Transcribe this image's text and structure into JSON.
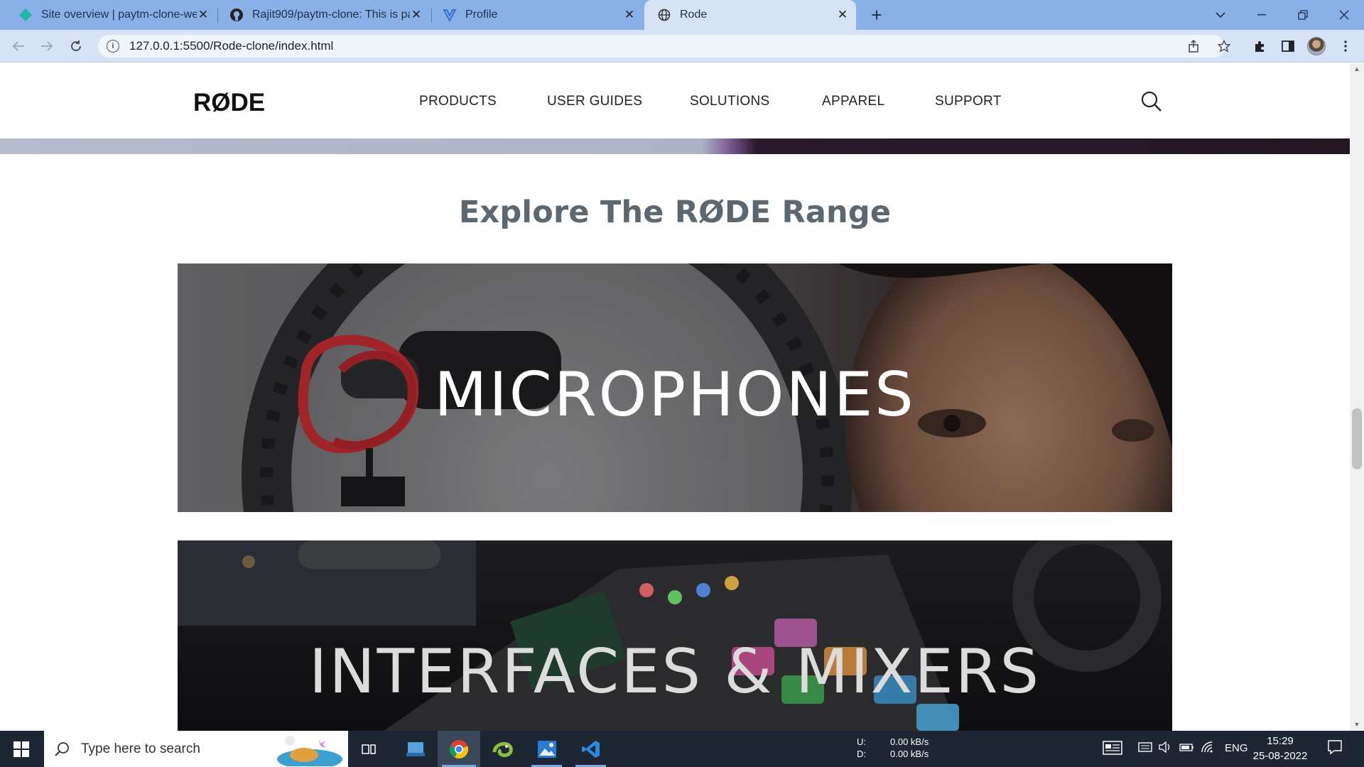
{
  "browser": {
    "tabs": [
      {
        "title": "Site overview | paytm-clone-web",
        "icon": "netlify-icon"
      },
      {
        "title": "Rajit909/paytm-clone: This is pay",
        "icon": "github-icon"
      },
      {
        "title": "Profile",
        "icon": "vite-icon"
      },
      {
        "title": "Rode",
        "icon": "globe-icon"
      }
    ],
    "url": "127.0.0.1:5500/Rode-clone/index.html"
  },
  "site": {
    "logo": "RØDE",
    "nav": [
      "PRODUCTS",
      "USER GUIDES",
      "SOLUTIONS",
      "APPAREL",
      "SUPPORT"
    ],
    "section_title": "Explore The RØDE Range",
    "cards": [
      {
        "label": "MICROPHONES"
      },
      {
        "label": "INTERFACES & MIXERS"
      }
    ]
  },
  "taskbar": {
    "search_placeholder": "Type here to search",
    "net_upload_label": "U:",
    "net_upload": "0.00 kB/s",
    "net_download_label": "D:",
    "net_download": "0.00 kB/s",
    "language": "ENG",
    "time": "15:29",
    "date": "25-08-2022"
  },
  "colors": {
    "tabstrip": "#8ab0e8",
    "active_tab": "#d6e3f7",
    "title_gray": "#5d6770",
    "taskbar": "#1d2632"
  }
}
